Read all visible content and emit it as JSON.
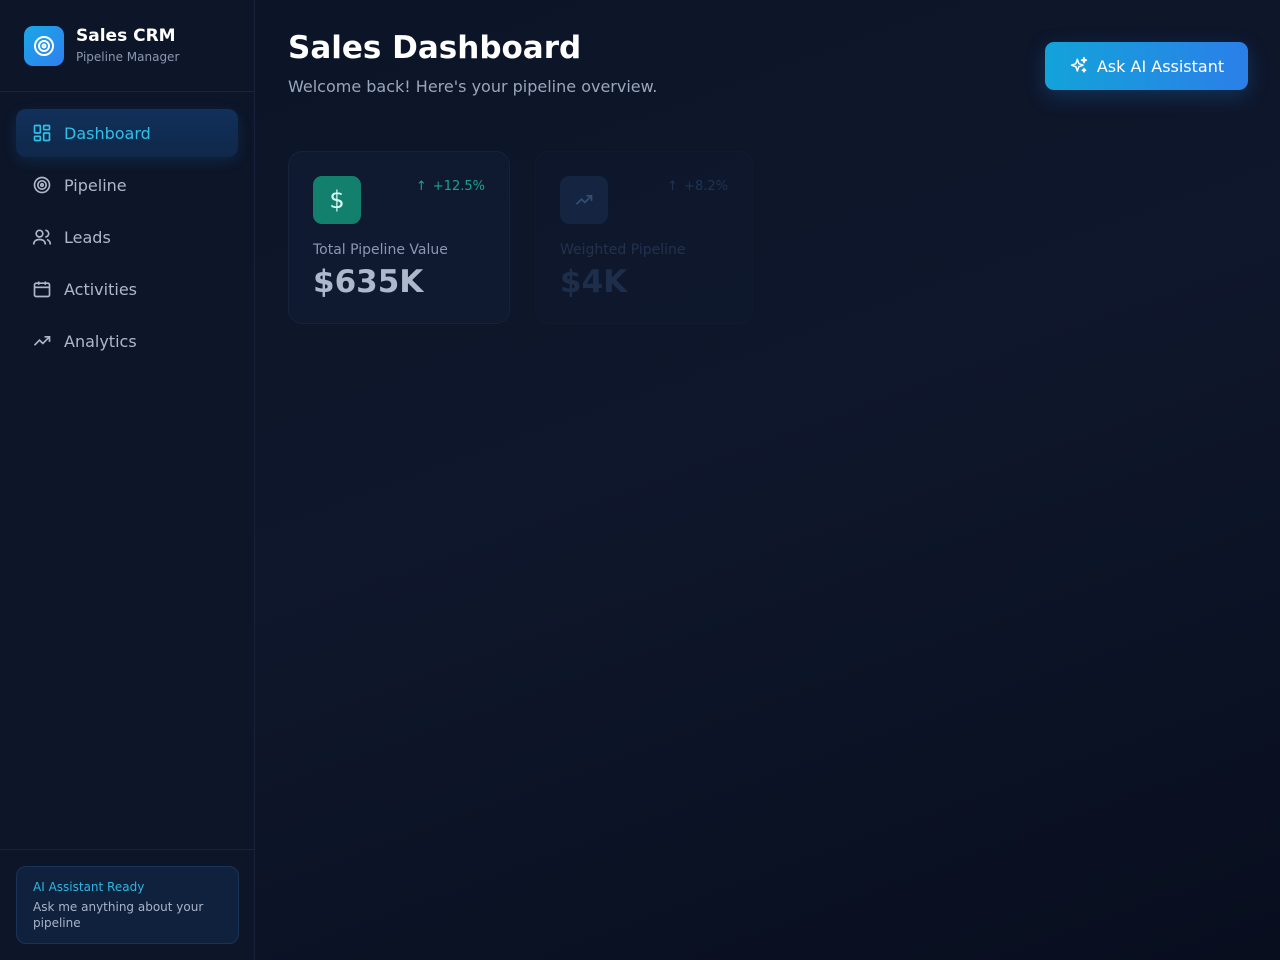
{
  "brand": {
    "title": "Sales CRM",
    "subtitle": "Pipeline Manager",
    "logo_icon": "target-icon",
    "logo_color_start": "#1aa7e6",
    "logo_color_end": "#2f7ff0"
  },
  "sidebar": {
    "items": [
      {
        "label": "Dashboard",
        "icon": "dashboard-grid-icon",
        "active": true
      },
      {
        "label": "Pipeline",
        "icon": "target-icon",
        "active": false
      },
      {
        "label": "Leads",
        "icon": "users-icon",
        "active": false
      },
      {
        "label": "Activities",
        "icon": "calendar-icon",
        "active": false
      },
      {
        "label": "Analytics",
        "icon": "trending-up-icon",
        "active": false
      }
    ],
    "assistant": {
      "title": "AI Assistant Ready",
      "text": "Ask me anything about your pipeline"
    }
  },
  "header": {
    "title": "Sales Dashboard",
    "subtitle": "Welcome back! Here's your pipeline overview.",
    "ai_button_label": "Ask AI Assistant",
    "ai_button_icon": "sparkles-icon"
  },
  "cards": [
    {
      "label": "Total Pipeline Value",
      "value": "$635K",
      "change": "+12.5%",
      "icon": "dollar-icon",
      "icon_color": "#13806e"
    },
    {
      "label": "Weighted Pipeline",
      "value": "$4K",
      "change": "+8.2%",
      "icon": "trending-up-icon",
      "icon_color": "#20406e"
    }
  ],
  "colors": {
    "accent": "#2fc0e8",
    "positive": "#1aa38a",
    "background": "#0b1224"
  }
}
